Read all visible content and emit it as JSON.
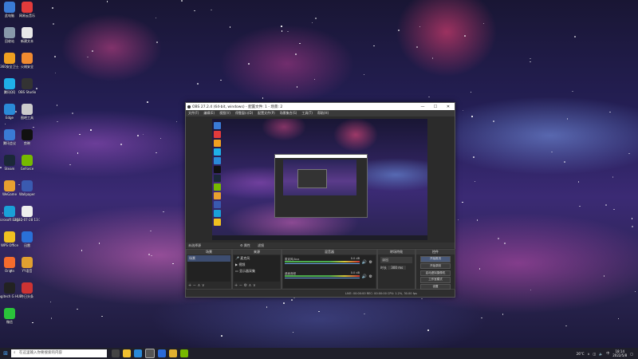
{
  "desktop": {
    "icons": [
      {
        "label": "此电脑",
        "color": "#3a7bd5"
      },
      {
        "label": "网易云音乐",
        "color": "#e23b3b"
      },
      {
        "label": "回收站",
        "color": "#8899aa"
      },
      {
        "label": "新建文本",
        "color": "#e8e8e8"
      },
      {
        "label": "360安全卫士",
        "color": "#f0a020"
      },
      {
        "label": "火绒安全",
        "color": "#f08a30"
      },
      {
        "label": "腾讯QQ",
        "color": "#1fb0e8"
      },
      {
        "label": "OBS Studio",
        "color": "#333"
      },
      {
        "label": "Edge",
        "color": "#2a8ad8"
      },
      {
        "label": "图吧工具",
        "color": "#ccc"
      },
      {
        "label": "腾讯会议",
        "color": "#3a7bd5"
      },
      {
        "label": "剪映",
        "color": "#111"
      },
      {
        "label": "Steam",
        "color": "#1b2838"
      },
      {
        "label": "GeForce",
        "color": "#76b900"
      },
      {
        "label": "WeGame",
        "color": "#e8a030"
      },
      {
        "label": "Wallpaper",
        "color": "#3a5ab0"
      },
      {
        "label": "Microsoft Edge 浏览器",
        "color": "#1aa0d8"
      },
      {
        "label": "2022-07-28 13:30",
        "color": "#eee"
      },
      {
        "label": "WPS Office",
        "color": "#f0c020"
      },
      {
        "label": "迅雷",
        "color": "#2a70d8"
      },
      {
        "label": "Origin",
        "color": "#f56c2d"
      },
      {
        "label": "YY语音",
        "color": "#e0a030"
      },
      {
        "label": "Logitech G HUB",
        "color": "#222"
      },
      {
        "label": "今日头条",
        "color": "#c33"
      },
      {
        "label": "微信",
        "color": "#2ac33a"
      }
    ]
  },
  "obs": {
    "title": "OBS 27.2.4 (64-bit, windows) - 配置文件: 1 - 场景: 2",
    "window_buttons": [
      "—",
      "☐",
      "✕"
    ],
    "menu": [
      "文件(F)",
      "编辑(E)",
      "视图(V)",
      "停靠窗口(D)",
      "配置文件(P)",
      "场景集合(S)",
      "工具(T)",
      "帮助(H)"
    ],
    "scene_header": "未选择源",
    "properties_btn": "⚙ 属性",
    "filters_btn": "滤镜",
    "docks": {
      "scenes": {
        "title": "场景",
        "items": [
          "场景"
        ]
      },
      "sources": {
        "title": "来源",
        "items": [
          "麦克风",
          "视频",
          "显示器采集"
        ]
      },
      "mixer": {
        "title": "混音器",
        "channels": [
          {
            "name": "麦克风/Aux",
            "db": "0.0 dB"
          },
          {
            "name": "桌面音频",
            "db": "0.0 dB"
          }
        ]
      },
      "transitions": {
        "title": "转场特效",
        "type": "淡出",
        "duration_label": "时长",
        "duration": "300 ms"
      },
      "controls": {
        "title": "控件",
        "buttons": [
          "开始推流",
          "开始录制",
          "启动虚拟摄像机",
          "工作室模式",
          "设置",
          "退出"
        ]
      }
    },
    "status": "LIVE: 00:00:00   REC: 00:00:00   CPU: 1.2%, 30.00 fps"
  },
  "taskbar": {
    "search_placeholder": "在这里输入你要搜索的内容",
    "tray_temp": "26°C",
    "time": "18:14",
    "date": "2022/5/8"
  }
}
